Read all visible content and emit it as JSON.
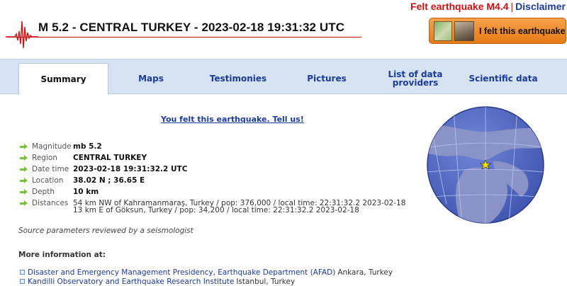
{
  "top_links": {
    "felt": "Felt earthquake M4.4",
    "separator": "|",
    "disclaimer": "Disclaimer"
  },
  "header": {
    "title": "M 5.2 - CENTRAL TURKEY - 2023-02-18 19:31:32 UTC",
    "felt_button_label": "I felt this earthquake"
  },
  "tabs": [
    {
      "label": "Summary",
      "active": true
    },
    {
      "label": "Maps"
    },
    {
      "label": "Testimonies"
    },
    {
      "label": "Pictures"
    },
    {
      "label": "List of data providers"
    },
    {
      "label": "Scientific data"
    }
  ],
  "tell_us": "You felt this earthquake. Tell us!",
  "details": {
    "magnitude": {
      "label": "Magnitude",
      "value": "mb 5.2"
    },
    "region": {
      "label": "Region",
      "value": "CENTRAL TURKEY"
    },
    "datetime": {
      "label": "Date time",
      "value": "2023-02-18 19:31:32.2 UTC"
    },
    "location": {
      "label": "Location",
      "value": "38.02 N ; 36.65 E"
    },
    "depth": {
      "label": "Depth",
      "value": "10 km"
    },
    "distances": {
      "label": "Distances",
      "line1": "54 km NW of Kahramanmaraş, Turkey / pop: 376,000 / local time: 22:31:32.2 2023-02-18",
      "line2": "13 km E of Göksun, Turkey / pop: 34,200 / local time: 22:31:32.2 2023-02-18"
    }
  },
  "reviewed": "Source parameters reviewed by a seismologist",
  "more_info": {
    "heading": "More information at:",
    "sources": [
      {
        "name": "Disaster and Emergency Management Presidency, Earthquake Department (AFAD)",
        "location": "Ankara, Turkey"
      },
      {
        "name": "Kandilli Observatory and Earthquake Research Institute",
        "location": "Istanbul, Turkey"
      }
    ]
  },
  "colors": {
    "link_blue": "#1a3aa0",
    "felt_red": "#d01010",
    "tab_band": "#d6e3f3",
    "arrow_green": "#7cbf3c",
    "button_orange": "#ef8a2a"
  },
  "icons": [
    "seismogram-logo-icon",
    "felt-map-icon",
    "felt-photo-icon",
    "arrow-right-icon",
    "square-bullet-icon",
    "globe-icon",
    "epicenter-star-icon"
  ]
}
